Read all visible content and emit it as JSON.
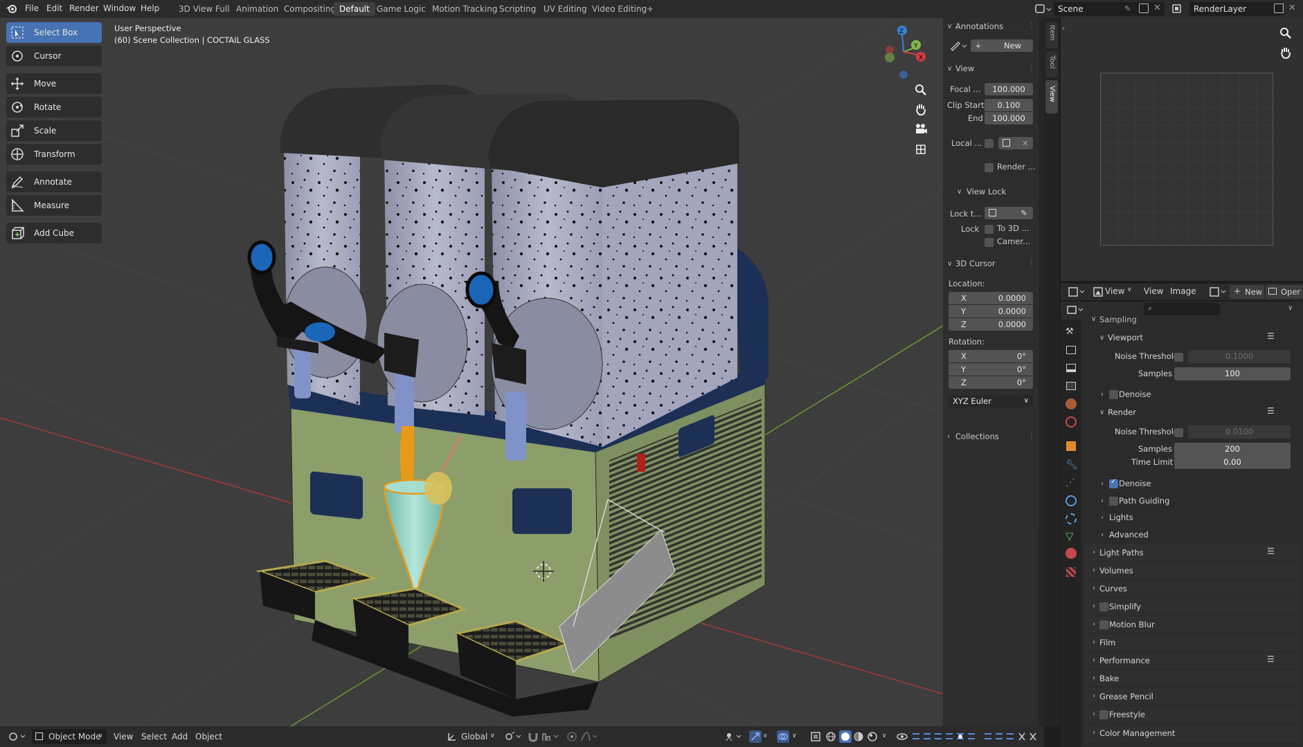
{
  "topbar": {
    "menus": [
      "File",
      "Edit",
      "Render",
      "Window",
      "Help"
    ],
    "workspaces": [
      "3D View Full",
      "Animation",
      "Compositing",
      "Default",
      "Game Logic",
      "Motion Tracking",
      "Scripting",
      "UV Editing",
      "Video Editing",
      "+"
    ],
    "active_workspace": "Default",
    "scene_name": "Scene",
    "view_layer": "RenderLayer"
  },
  "viewport": {
    "perspective": "User Perspective",
    "collection": "(60) Scene Collection | COCTAIL GLASS",
    "tools": [
      "Select Box",
      "Cursor",
      "Move",
      "Rotate",
      "Scale",
      "Transform",
      "Annotate",
      "Measure",
      "Add Cube"
    ],
    "gizmo_axes": [
      "Z",
      "Y",
      "X"
    ]
  },
  "npanel": {
    "tabs": [
      "Item",
      "Tool",
      "View"
    ],
    "annotations": {
      "title": "Annotations",
      "new_label": "New"
    },
    "view": {
      "title": "View",
      "focal_label": "Focal ...",
      "focal_value": "100.000",
      "clip_start_label": "Clip Start",
      "clip_start_value": "0.100",
      "end_label": "End",
      "end_value": "100.000",
      "local_label": "Local ...",
      "render_label": "Render ...",
      "view_lock_title": "View Lock",
      "lock_to_label": "Lock t...",
      "lock_label": "Lock",
      "to_3d_label": "To 3D ...",
      "camera_label": "Camer..."
    },
    "cursor": {
      "title": "3D Cursor",
      "location_label": "Location:",
      "loc": [
        {
          "axis": "X",
          "value": "0.0000"
        },
        {
          "axis": "Y",
          "value": "0.0000"
        },
        {
          "axis": "Z",
          "value": "0.0000"
        }
      ],
      "rotation_label": "Rotation:",
      "rot": [
        {
          "axis": "X",
          "value": "0°"
        },
        {
          "axis": "Y",
          "value": "0°"
        },
        {
          "axis": "Z",
          "value": "0°"
        }
      ],
      "euler": "XYZ Euler"
    },
    "collections_title": "Collections"
  },
  "image_editor": {
    "menus": [
      "View",
      "View",
      "Image"
    ],
    "new_label": "New",
    "open_label": "Oper"
  },
  "properties": {
    "sampling_title": "Sampling",
    "viewport_title": "Viewport",
    "viewport_noise_label": "Noise Threshold",
    "viewport_noise_value": "0.1000",
    "viewport_samples_label": "Samples",
    "viewport_samples_value": "100",
    "viewport_denoise": "Denoise",
    "render_title": "Render",
    "render_noise_label": "Noise Threshold",
    "render_noise_value": "0.0100",
    "render_samples_label": "Samples",
    "render_samples_value": "200",
    "time_limit_label": "Time Limit",
    "time_limit_value": "0.00",
    "render_denoise": "Denoise",
    "path_guiding": "Path Guiding",
    "lights": "Lights",
    "advanced": "Advanced",
    "sections": [
      "Light Paths",
      "Volumes",
      "Curves",
      "Simplify",
      "Motion Blur",
      "Film",
      "Performance",
      "Bake",
      "Grease Pencil",
      "Freestyle",
      "Color Management"
    ]
  },
  "bottombar": {
    "mode": "Object Mode",
    "menus": [
      "View",
      "Select",
      "Add",
      "Object"
    ],
    "orientation": "Global"
  },
  "colors": {
    "accent": "#4772b3",
    "viewport_bg": "#3d3d3d",
    "panel_bg": "#2b2b2b",
    "machine_green": "#8c9e6a",
    "machine_navy": "#1c2f55",
    "drink_orange": "#e59a1a",
    "glass_teal": "#9ad6c6"
  }
}
